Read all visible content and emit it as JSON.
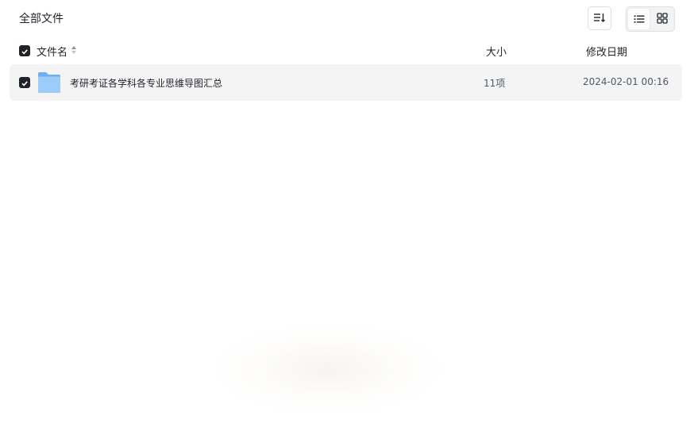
{
  "page": {
    "title": "全部文件"
  },
  "toolbar": {
    "sort_icon": "sort-lines-icon",
    "view_modes": [
      {
        "name": "list",
        "icon": "list-icon",
        "active": true
      },
      {
        "name": "grid",
        "icon": "grid-icon",
        "active": false
      }
    ]
  },
  "table": {
    "columns": {
      "name": "文件名",
      "size": "大小",
      "date": "修改日期"
    },
    "select_all_checked": true,
    "rows": [
      {
        "checked": true,
        "type": "folder",
        "name": "考研考证各学科各专业思维导图汇总",
        "size": "11项",
        "date": "2024-02-01 00:16"
      }
    ]
  },
  "colors": {
    "checkbox": "#1f2329",
    "row_selected_bg": "#f4f4f5",
    "folder_light": "#9ccdf9",
    "folder_dark": "#6ab0f3"
  }
}
